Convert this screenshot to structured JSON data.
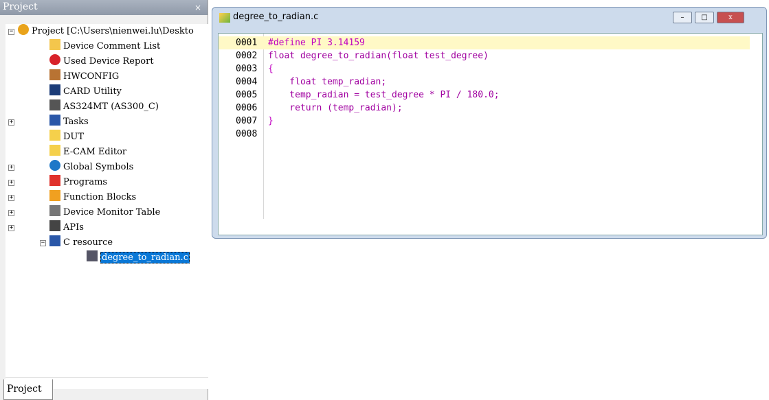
{
  "panel": {
    "title": "Project",
    "controls": " ×",
    "tab": "Project"
  },
  "tree": [
    "Project [C:\\Users\\nienwei.lu\\Deskto",
    "Device Comment List",
    "Used Device Report",
    "HWCONFIG",
    "CARD Utility",
    "AS324MT (AS300_C)",
    "Tasks",
    "DUT",
    "E-CAM Editor",
    "Global Symbols",
    "Programs",
    "Function Blocks",
    "Device Monitor Table",
    "APIs",
    "C resource",
    "degree_to_radian.c"
  ],
  "doc": {
    "title": "degree_to_radian.c",
    "min": "–",
    "max": "□",
    "close": "x"
  },
  "lines": [
    "0001",
    "0002",
    "0003",
    "0004",
    "0005",
    "0006",
    "0007",
    "0008"
  ],
  "code": [
    "#define PI 3.14159",
    "float degree_to_radian(float test_degree)",
    "{",
    "    float temp_radian;",
    "    temp_radian = test_degree * PI / 180.0;",
    "    return (temp_radian);",
    "}",
    ""
  ]
}
